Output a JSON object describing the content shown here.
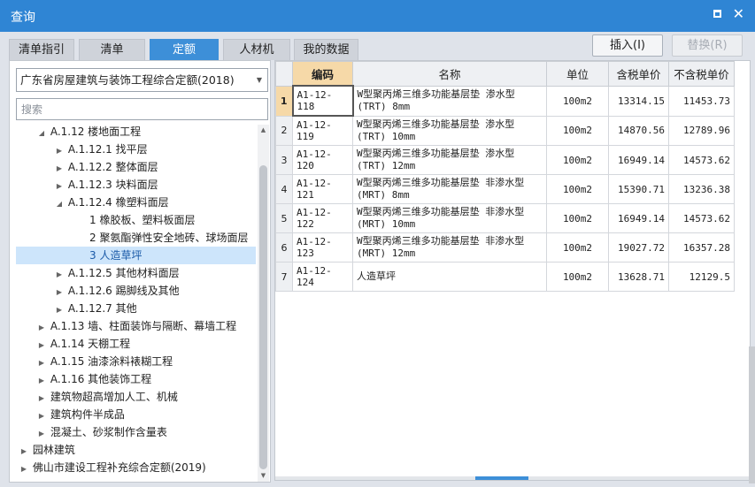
{
  "window": {
    "title": "查询"
  },
  "tabs": [
    {
      "label": "清单指引",
      "active": false
    },
    {
      "label": "清单",
      "active": false
    },
    {
      "label": "定额",
      "active": true
    },
    {
      "label": "人材机",
      "active": false
    },
    {
      "label": "我的数据",
      "active": false
    }
  ],
  "toolbar": {
    "insert_label": "插入(I)",
    "replace_label": "替换(R)"
  },
  "library": {
    "selected": "广东省房屋建筑与装饰工程综合定额(2018)"
  },
  "search": {
    "placeholder": "搜索",
    "value": ""
  },
  "tree": [
    {
      "label": "A.1.12 楼地面工程",
      "toggle": "expanded"
    },
    {
      "label": "A.1.12.1 找平层",
      "toggle": "collapsed"
    },
    {
      "label": "A.1.12.2 整体面层",
      "toggle": "collapsed"
    },
    {
      "label": "A.1.12.3 块料面层",
      "toggle": "collapsed"
    },
    {
      "label": "A.1.12.4 橡塑料面层",
      "toggle": "expanded"
    },
    {
      "label": "1 橡胶板、塑料板面层",
      "toggle": "none"
    },
    {
      "label": "2 聚氨酯弹性安全地砖、球场面层",
      "toggle": "none"
    },
    {
      "label": "3 人造草坪",
      "toggle": "none",
      "selected": true
    },
    {
      "label": "A.1.12.5 其他材料面层",
      "toggle": "collapsed"
    },
    {
      "label": "A.1.12.6 踢脚线及其他",
      "toggle": "collapsed"
    },
    {
      "label": "A.1.12.7 其他",
      "toggle": "collapsed"
    },
    {
      "label": "A.1.13 墙、柱面装饰与隔断、幕墙工程",
      "toggle": "collapsed"
    },
    {
      "label": "A.1.14 天棚工程",
      "toggle": "collapsed"
    },
    {
      "label": "A.1.15 油漆涂料裱糊工程",
      "toggle": "collapsed"
    },
    {
      "label": "A.1.16 其他装饰工程",
      "toggle": "collapsed"
    },
    {
      "label": "建筑物超高增加人工、机械",
      "toggle": "collapsed"
    },
    {
      "label": "建筑构件半成品",
      "toggle": "collapsed"
    },
    {
      "label": "混凝土、砂浆制作含量表",
      "toggle": "collapsed"
    },
    {
      "label": "园林建筑",
      "toggle": "collapsed"
    },
    {
      "label": "佛山市建设工程补充综合定额(2019)",
      "toggle": "collapsed"
    }
  ],
  "table": {
    "columns": [
      "编码",
      "名称",
      "单位",
      "含税单价",
      "不含税单价"
    ],
    "rows": [
      {
        "no": "1",
        "code": "A1-12-118",
        "name": "W型聚丙烯三维多功能基层垫 渗水型(TRT) 8mm",
        "unit": "100m2",
        "tax_price": "13314.15",
        "notax_price": "11453.73"
      },
      {
        "no": "2",
        "code": "A1-12-119",
        "name": "W型聚丙烯三维多功能基层垫 渗水型(TRT) 10mm",
        "unit": "100m2",
        "tax_price": "14870.56",
        "notax_price": "12789.96"
      },
      {
        "no": "3",
        "code": "A1-12-120",
        "name": "W型聚丙烯三维多功能基层垫 渗水型(TRT) 12mm",
        "unit": "100m2",
        "tax_price": "16949.14",
        "notax_price": "14573.62"
      },
      {
        "no": "4",
        "code": "A1-12-121",
        "name": "W型聚丙烯三维多功能基层垫 非渗水型(MRT) 8mm",
        "unit": "100m2",
        "tax_price": "15390.71",
        "notax_price": "13236.38"
      },
      {
        "no": "5",
        "code": "A1-12-122",
        "name": "W型聚丙烯三维多功能基层垫 非渗水型(MRT) 10mm",
        "unit": "100m2",
        "tax_price": "16949.14",
        "notax_price": "14573.62"
      },
      {
        "no": "6",
        "code": "A1-12-123",
        "name": "W型聚丙烯三维多功能基层垫 非渗水型(MRT) 12mm",
        "unit": "100m2",
        "tax_price": "19027.72",
        "notax_price": "16357.28"
      },
      {
        "no": "7",
        "code": "A1-12-124",
        "name": "人造草坪",
        "unit": "100m2",
        "tax_price": "13628.71",
        "notax_price": "12129.5"
      }
    ]
  },
  "colors": {
    "titlebar": "#2f85d4",
    "active_tab": "#3d8fd8",
    "header_highlight": "#f6d9a8",
    "tree_selection": "#cde5fb"
  }
}
